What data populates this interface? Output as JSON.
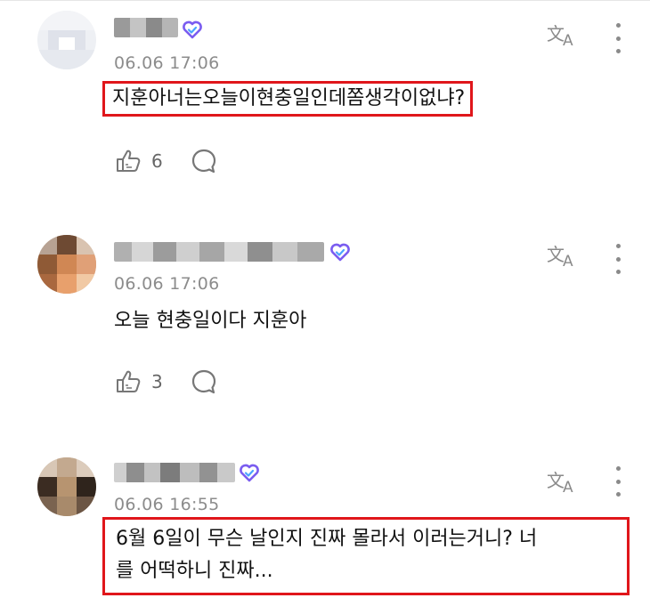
{
  "comments": [
    {
      "time": "06.06 17:06",
      "text": "지훈아너는오늘이현충일인데쫌생각이없냐?",
      "likes": "6",
      "highlighted": true
    },
    {
      "time": "06.06 17:06",
      "text": "오늘 현충일이다 지훈아",
      "likes": "3",
      "highlighted": false
    },
    {
      "time": "06.06 16:55",
      "text_line1": "6월 6일이 무슨 날인지 진짜 몰라서 이러는거니? 너",
      "text_line2": "를 어떡하니 진짜...",
      "highlighted": true
    }
  ],
  "icons": {
    "verified": "heart-check-badge-icon",
    "translate": "translate-icon",
    "more": "more-vertical-icon",
    "like": "thumbs-up-icon",
    "reply": "comment-bubble-icon"
  },
  "colors": {
    "highlight": "#e0161b",
    "badge": "#7a5cf0",
    "meta": "#8c8c8c"
  }
}
